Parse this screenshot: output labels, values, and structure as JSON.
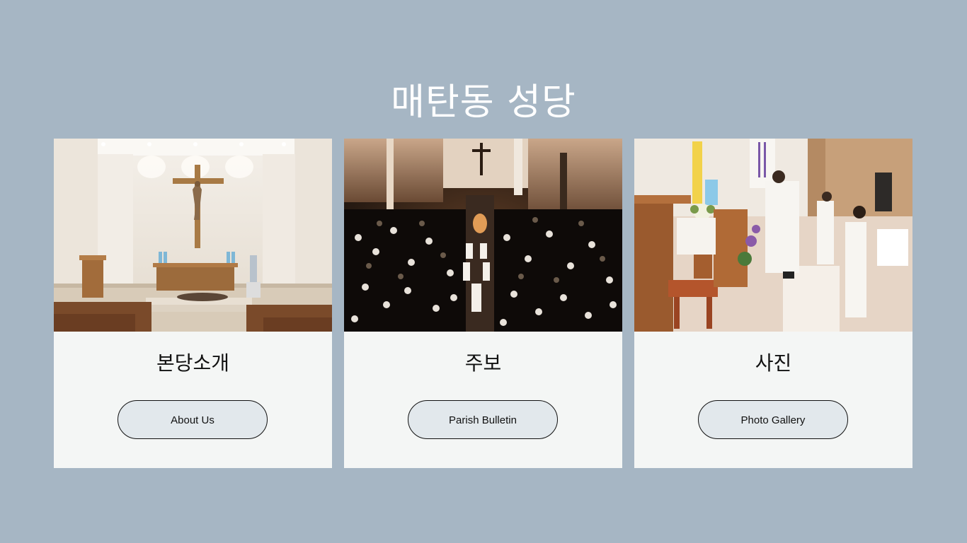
{
  "header": {
    "title": "매탄동 성당"
  },
  "cards": [
    {
      "heading": "본당소개",
      "button_label": "About Us",
      "image_alt": "church sanctuary interior with crucifix and altar"
    },
    {
      "heading": "주보",
      "button_label": "Parish Bulletin",
      "image_alt": "crowded congregation during candlelight mass"
    },
    {
      "heading": "사진",
      "button_label": "Photo Gallery",
      "image_alt": "priest lighting the paschal candle with altar servers"
    }
  ],
  "colors": {
    "background": "#a6b6c4",
    "card": "#f4f6f5",
    "button": "#e2e8ec",
    "title": "#ffffff"
  }
}
